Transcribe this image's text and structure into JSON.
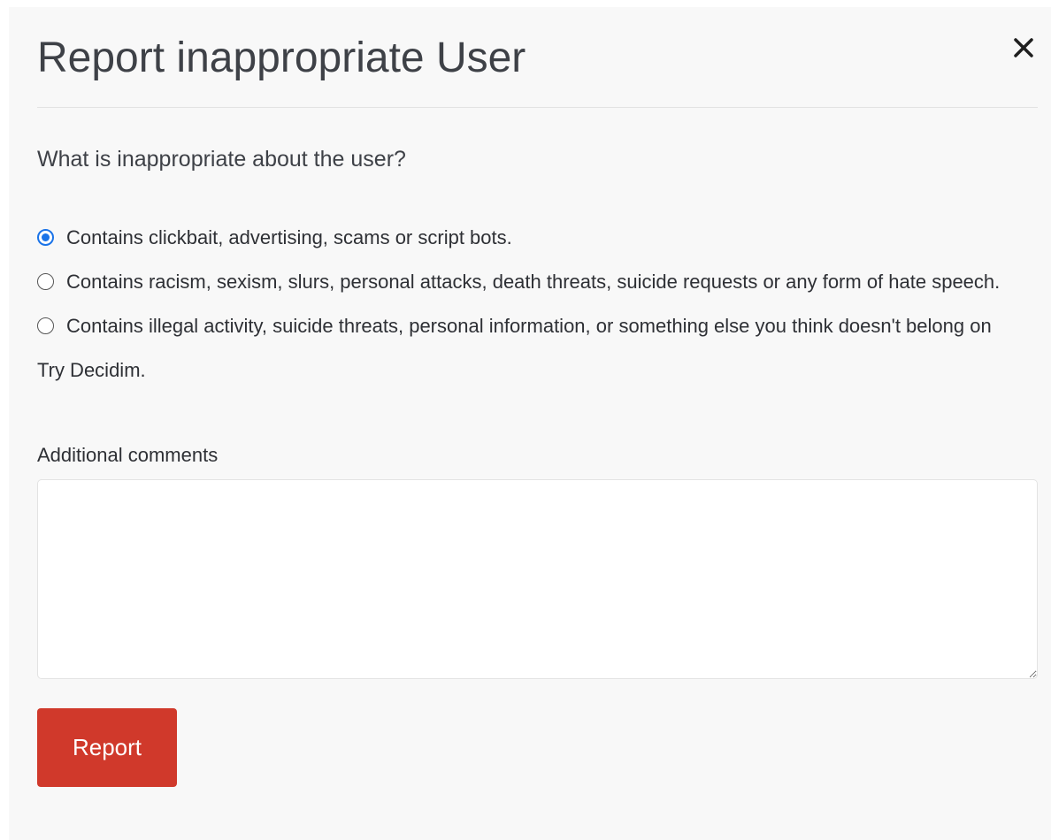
{
  "modal": {
    "title": "Report inappropriate User",
    "close_label": "×",
    "question": "What is inappropriate about the user?",
    "options": [
      {
        "label": "Contains clickbait, advertising, scams or script bots.",
        "checked": true
      },
      {
        "label": "Contains racism, sexism, slurs, personal attacks, death threats, suicide requests or any form of hate speech.",
        "checked": false
      },
      {
        "label": "Contains illegal activity, suicide threats, personal information, or something else you think doesn't belong on Try Decidim.",
        "checked": false
      }
    ],
    "comments_label": "Additional comments",
    "comments_value": "",
    "submit_label": "Report"
  },
  "colors": {
    "accent": "#1a73e8",
    "button": "#d0392b",
    "background": "#f8f8f8"
  }
}
